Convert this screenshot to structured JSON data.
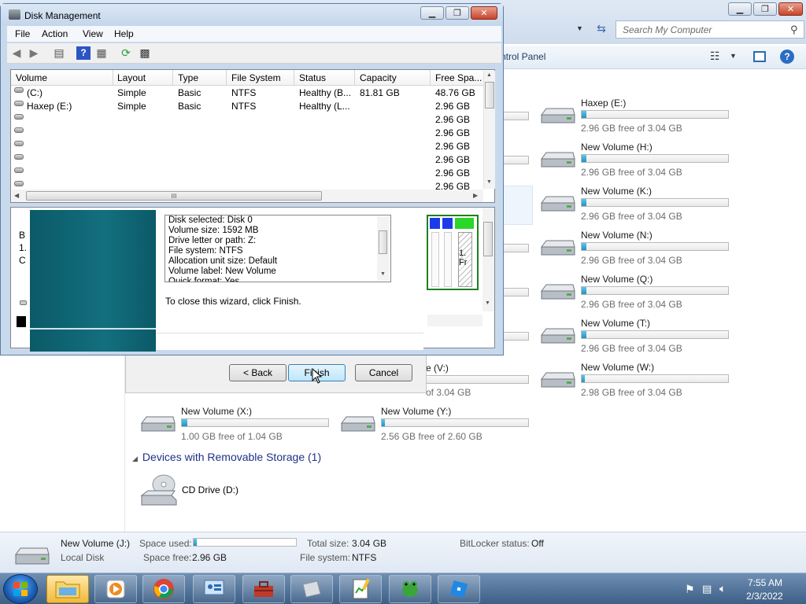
{
  "explorer": {
    "search_placeholder": "Search My Computer",
    "breadcrumb_partial": "ntrol Panel",
    "drives": [
      {
        "name": "Haxep (E:)",
        "free": "2.96 GB free of 3.04 GB",
        "used_fraction": 0.03
      },
      {
        "name": "New Volume (H:)",
        "free": "2.96 GB free of 3.04 GB",
        "used_fraction": 0.03
      },
      {
        "name": "New Volume (K:)",
        "free": "2.96 GB free of 3.04 GB",
        "used_fraction": 0.03
      },
      {
        "name": "New Volume (N:)",
        "free": "2.96 GB free of 3.04 GB",
        "used_fraction": 0.03
      },
      {
        "name": "New Volume (Q:)",
        "free": "2.96 GB free of 3.04 GB",
        "used_fraction": 0.03
      },
      {
        "name": "New Volume (T:)",
        "free": "2.96 GB free of 3.04 GB",
        "used_fraction": 0.03
      },
      {
        "name": "New Volume (W:)",
        "free": "2.98 GB free of 3.04 GB",
        "used_fraction": 0.02
      },
      {
        "name": "New Volume (X:)",
        "free": "1.00 GB free of 1.04 GB",
        "used_fraction": 0.04
      },
      {
        "name": "New Volume (Y:)",
        "free": "2.56 GB free of 2.60 GB",
        "used_fraction": 0.02
      }
    ],
    "partial_drive": {
      "name": "e (V:)",
      "free": "of 3.04 GB"
    },
    "removable_group": "Devices with Removable Storage (1)",
    "cd_drive": "CD Drive (D:)",
    "details": {
      "name": "New Volume (J:)",
      "type": "Local Disk",
      "space_used_label": "Space used:",
      "space_free_label": "Space free:",
      "space_free": "2.96 GB",
      "total_size_label": "Total size:",
      "total_size": "3.04 GB",
      "file_system_label": "File system:",
      "file_system": "NTFS",
      "bitlocker_label": "BitLocker status:",
      "bitlocker": "Off",
      "used_fraction": 0.03
    }
  },
  "wizard": {
    "back": "< Back",
    "finish": "Finish",
    "cancel": "Cancel",
    "close_text": "To close this wizard, click Finish.",
    "summary": [
      "Disk selected: Disk 0",
      "Volume size: 1592 MB",
      "Drive letter or path: Z:",
      "File system: NTFS",
      "Allocation unit size: Default",
      "Volume label: New Volume",
      "Quick format: Yes"
    ]
  },
  "disk_management": {
    "title": "Disk Management",
    "menu": [
      "File",
      "Action",
      "View",
      "Help"
    ],
    "columns": [
      "Volume",
      "Layout",
      "Type",
      "File System",
      "Status",
      "Capacity",
      "Free Spa..."
    ],
    "rows": [
      {
        "volume": "(C:)",
        "layout": "Simple",
        "type": "Basic",
        "fs": "NTFS",
        "status": "Healthy (B...",
        "capacity": "81.81 GB",
        "free": "48.76 GB"
      },
      {
        "volume": "Haxep (E:)",
        "layout": "Simple",
        "type": "Basic",
        "fs": "NTFS",
        "status": "Healthy (L...",
        "capacity": "",
        "free": "2.96 GB"
      },
      {
        "volume": "",
        "layout": "",
        "type": "",
        "fs": "",
        "status": "",
        "capacity": "",
        "free": "2.96 GB"
      },
      {
        "volume": "",
        "layout": "",
        "type": "",
        "fs": "",
        "status": "",
        "capacity": "",
        "free": "2.96 GB"
      },
      {
        "volume": "",
        "layout": "",
        "type": "",
        "fs": "",
        "status": "",
        "capacity": "",
        "free": "2.96 GB"
      },
      {
        "volume": "",
        "layout": "",
        "type": "",
        "fs": "",
        "status": "",
        "capacity": "",
        "free": "2.96 GB"
      },
      {
        "volume": "",
        "layout": "",
        "type": "",
        "fs": "",
        "status": "",
        "capacity": "",
        "free": "2.96 GB"
      },
      {
        "volume": "",
        "layout": "",
        "type": "",
        "fs": "",
        "status": "",
        "capacity": "",
        "free": "2.96 GB"
      }
    ],
    "left_stub": [
      "B",
      "1.",
      "C"
    ],
    "map_text": [
      "1.",
      "Fr"
    ]
  },
  "taskbar": {
    "time": "7:55 AM",
    "date": "2/3/2022"
  },
  "colors": {
    "bar_fill": "#2191c6",
    "wizard_teal": "#136f7e",
    "map_border": "#1f7f1f",
    "map_blue": "#1a3ce8",
    "map_green": "#2bd62b"
  }
}
